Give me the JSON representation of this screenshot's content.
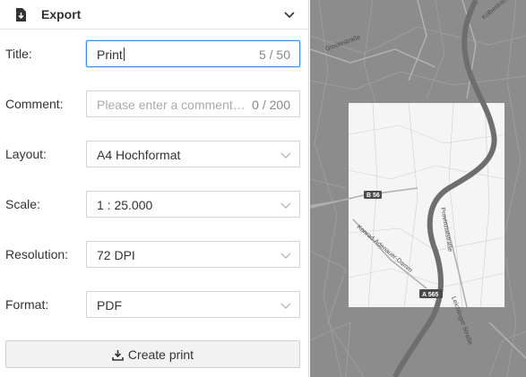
{
  "header": {
    "title": "Export"
  },
  "form": {
    "title": {
      "label": "Title:",
      "value": "Print",
      "counter": "5 / 50"
    },
    "comment": {
      "label": "Comment:",
      "placeholder": "Please enter a comment…",
      "counter": "0 / 200"
    },
    "layout": {
      "label": "Layout:",
      "value": "A4 Hochformat"
    },
    "scale": {
      "label": "Scale:",
      "value": "1 : 25.000"
    },
    "resolution": {
      "label": "Resolution:",
      "value": "72 DPI"
    },
    "format": {
      "label": "Format:",
      "value": "PDF"
    }
  },
  "actions": {
    "create_label": "Create print"
  },
  "map": {
    "labels": {
      "grootestrasse": "Grootestraße",
      "kolbe": "Kolbestraße",
      "konrad": "Konrad-Adenauer-Damm",
      "provinzial": "Provinzialstraße",
      "leichlinger": "Leichlinger Straße"
    },
    "shields": {
      "b56": "B 56",
      "a565": "A 565"
    }
  },
  "colors": {
    "accent": "#3f8ee4",
    "map_bg": "#8c8c8c",
    "print_frame": "#f5f5f5",
    "river": "#6e6e6e"
  },
  "icons": {
    "header": "export-icon",
    "collapse": "chevron-up-icon",
    "dropdown": "chevron-down-icon",
    "create": "download-icon"
  }
}
